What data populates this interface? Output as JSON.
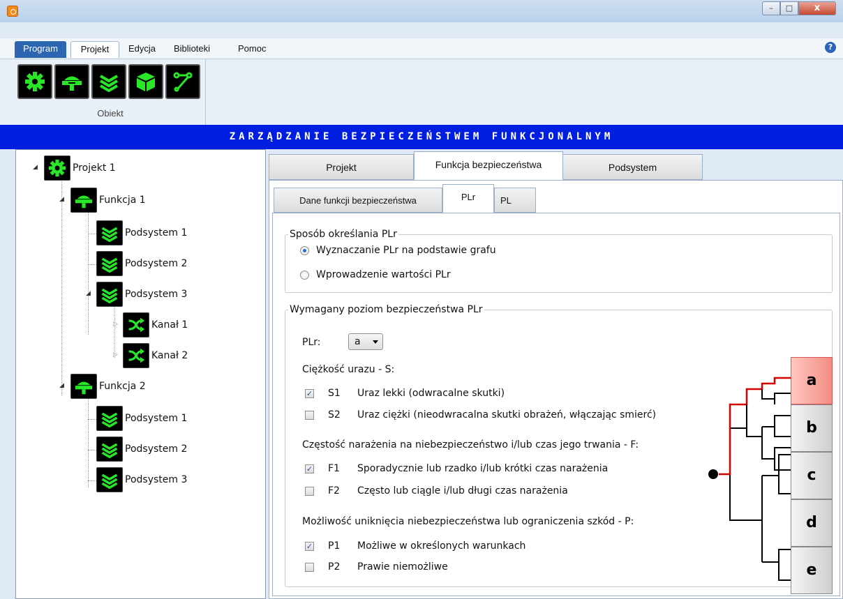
{
  "window": {
    "minimize_glyph": "–",
    "maximize_glyph": "□",
    "close_glyph": "x"
  },
  "menu": {
    "program": "Program",
    "projekt": "Projekt",
    "edycja": "Edycja",
    "biblioteki": "Biblioteki",
    "pomoc": "Pomoc",
    "help_glyph": "?"
  },
  "ribbon": {
    "group_label": "Obiekt",
    "buttons": [
      "gear-icon",
      "function-icon",
      "layers-icon",
      "cube-icon",
      "channel-icon"
    ],
    "icon_color": "#28e628"
  },
  "banner": {
    "title": "ZARZĄDZANIE BEZPIECZEŃSTWEM FUNKCJONALNYM",
    "color": "#001ee0"
  },
  "tree": {
    "projekt": "Projekt 1",
    "f1": "Funkcja 1",
    "f1_p1": "Podsystem 1",
    "f1_p2": "Podsystem 2",
    "f1_p3": "Podsystem 3",
    "k1": "Kanał 1",
    "k2": "Kanał 2",
    "f2": "Funkcja 2",
    "f2_p1": "Podsystem 1",
    "f2_p2": "Podsystem 2",
    "f2_p3": "Podsystem 3"
  },
  "tabs": {
    "top": [
      "Projekt",
      "Funkcja bezpieczeństwa",
      "Podsystem"
    ],
    "active_top": "Funkcja bezpieczeństwa",
    "sub": [
      "Dane funkcji bezpieczeństwa",
      "PLr",
      "PL"
    ],
    "active_sub": "PLr"
  },
  "method": {
    "legend": "Sposób określania PLr",
    "opt1": "Wyznaczanie PLr na podstawie grafu",
    "opt2": "Wprowadzenie wartości PLr",
    "selected": "opt1"
  },
  "required": {
    "legend": "Wymagany poziom bezpieczeństwa PLr",
    "plr_label": "PLr:",
    "plr_value": "a",
    "s_title": "Ciężkość urazu - S:",
    "s1_code": "S1",
    "s1_text": "Uraz lekki (odwracalne skutki)",
    "s1_checked": true,
    "s2_code": "S2",
    "s2_text": "Uraz ciężki (nieodwracalna skutki obrażeń, włączając smierć)",
    "s2_checked": false,
    "f_title": "Częstość narażenia na niebezpieczeństwo i/lub czas jego trwania - F:",
    "f1_code": "F1",
    "f1_text": "Sporadycznie lub rzadko i/lub krótki czas narażenia",
    "f1_checked": true,
    "f2_code": "F2",
    "f2_text": "Często lub ciągle i/lub długi czas narażenia",
    "f2_checked": false,
    "p_title": "Możliwość uniknięcia niebezpieczeństwa lub ograniczenia szkód - P:",
    "p1_code": "P1",
    "p1_text": "Możliwe w określonych warunkach",
    "p1_checked": true,
    "p2_code": "P2",
    "p2_text": "Prawie niemożliwe",
    "p2_checked": false
  },
  "graph": {
    "levels": [
      "a",
      "b",
      "c",
      "d",
      "e"
    ],
    "selected": "a",
    "path_color": "#d40000",
    "line_color": "#000000"
  },
  "check_glyph": "✓"
}
